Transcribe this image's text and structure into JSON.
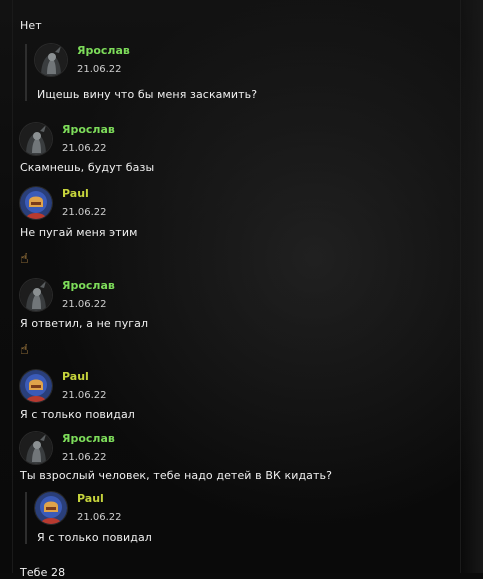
{
  "colors": {
    "name_yaroslav": "#7ddc5a",
    "name_paul": "#c6d43c",
    "text": "#f1f1f1",
    "date": "#cfcfcf"
  },
  "top_text": "Нет",
  "quote1": {
    "author": "Ярослав",
    "date": "21.06.22",
    "text": "Ищешь вину что бы меня заскамить?"
  },
  "messages": [
    {
      "author": "Ярослав",
      "date": "21.06.22",
      "text": "Скамнешь, будут базы"
    },
    {
      "author": "Paul",
      "date": "21.06.22",
      "text": "Не пугай меня этим",
      "emoji": "☝"
    },
    {
      "author": "Ярослав",
      "date": "21.06.22",
      "text": "Я ответил, а не пугал",
      "emoji": "☝"
    },
    {
      "author": "Paul",
      "date": "21.06.22",
      "text": "Я с только повидал"
    },
    {
      "author": "Ярослав",
      "date": "21.06.22",
      "text": "Ты взрослый человек, тебе надо детей в ВК кидать?"
    }
  ],
  "quote2": {
    "author": "Paul",
    "date": "21.06.22",
    "text": "Я с только повидал"
  },
  "bottom_text": "Тебе 28",
  "icons": {
    "avatar_yaroslav": "dark-hooded-figure-avatar",
    "avatar_paul": "blue-knight-avatar",
    "emoji": "pointing-up-emoji"
  }
}
